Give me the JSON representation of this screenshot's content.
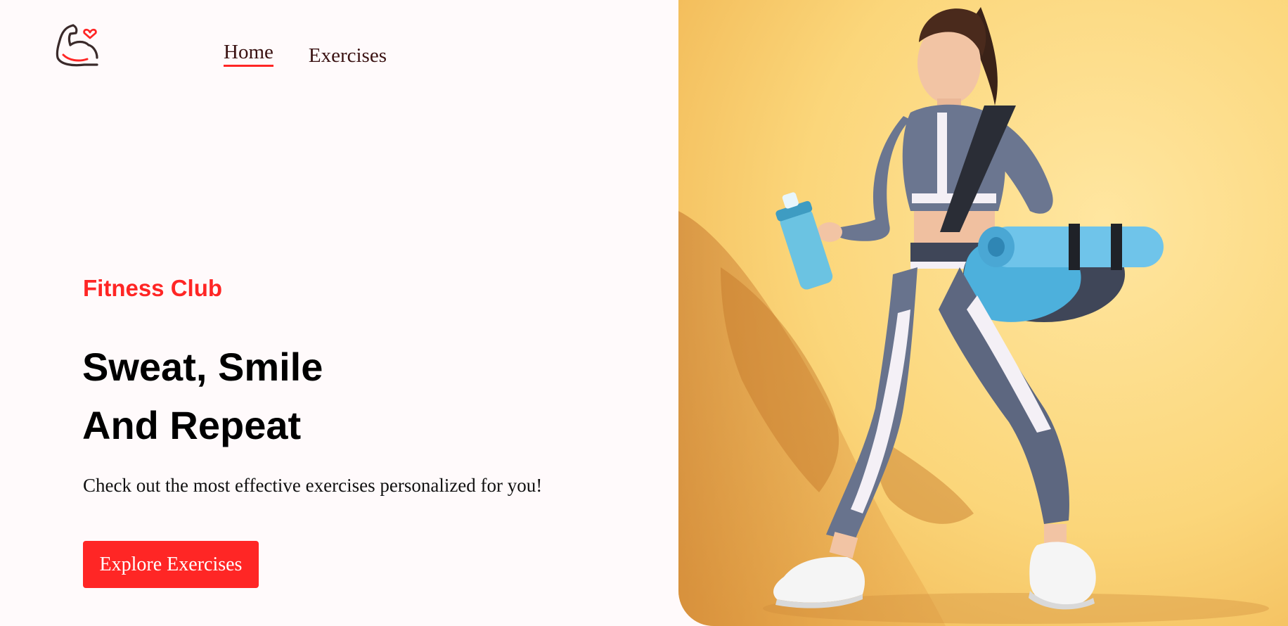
{
  "nav": {
    "home_label": "Home",
    "exercises_label": "Exercises"
  },
  "hero": {
    "eyebrow": "Fitness Club",
    "headline_line1": "Sweat, Smile",
    "headline_line2": "And Repeat",
    "subtitle": "Check out the most effective exercises personalized for you!",
    "cta_label": "Explore Exercises"
  },
  "colors": {
    "accent": "#ff2625",
    "background": "#fffafb",
    "hero_bg": "#fbd67a"
  },
  "icons": {
    "logo": "flexed-arm-heart-icon"
  }
}
